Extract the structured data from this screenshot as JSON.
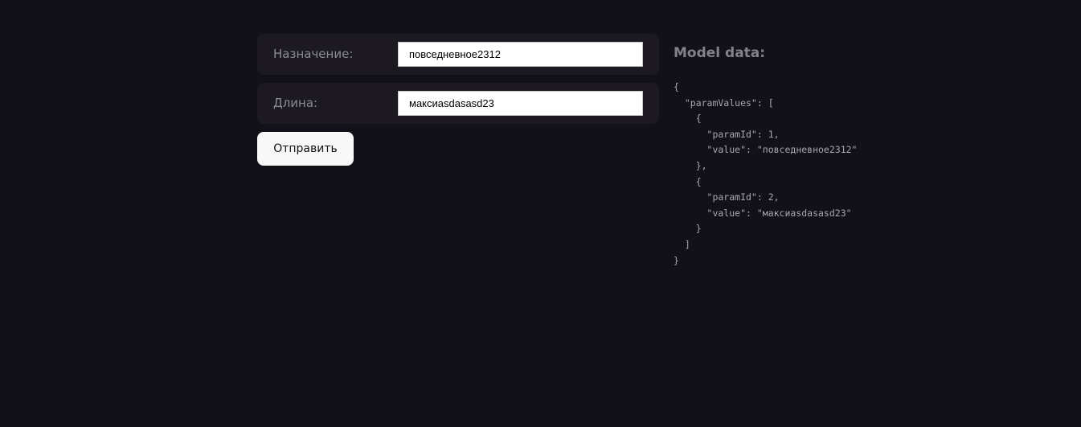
{
  "form": {
    "fields": [
      {
        "label": "Назначение:",
        "value": "повседневное2312"
      },
      {
        "label": "Длина:",
        "value": "максиasdasasd23"
      }
    ],
    "submit_label": "Отправить"
  },
  "model": {
    "title": "Model data:",
    "json_text": "{\n  \"paramValues\": [\n    {\n      \"paramId\": 1,\n      \"value\": \"повседневное2312\"\n    },\n    {\n      \"paramId\": 2,\n      \"value\": \"максиasdasasd23\"\n    }\n  ]\n}"
  },
  "colors": {
    "background": "#131118",
    "row_background": "#1c1a20",
    "label_text": "#8d8a93",
    "button_background": "#f8f8f8"
  }
}
